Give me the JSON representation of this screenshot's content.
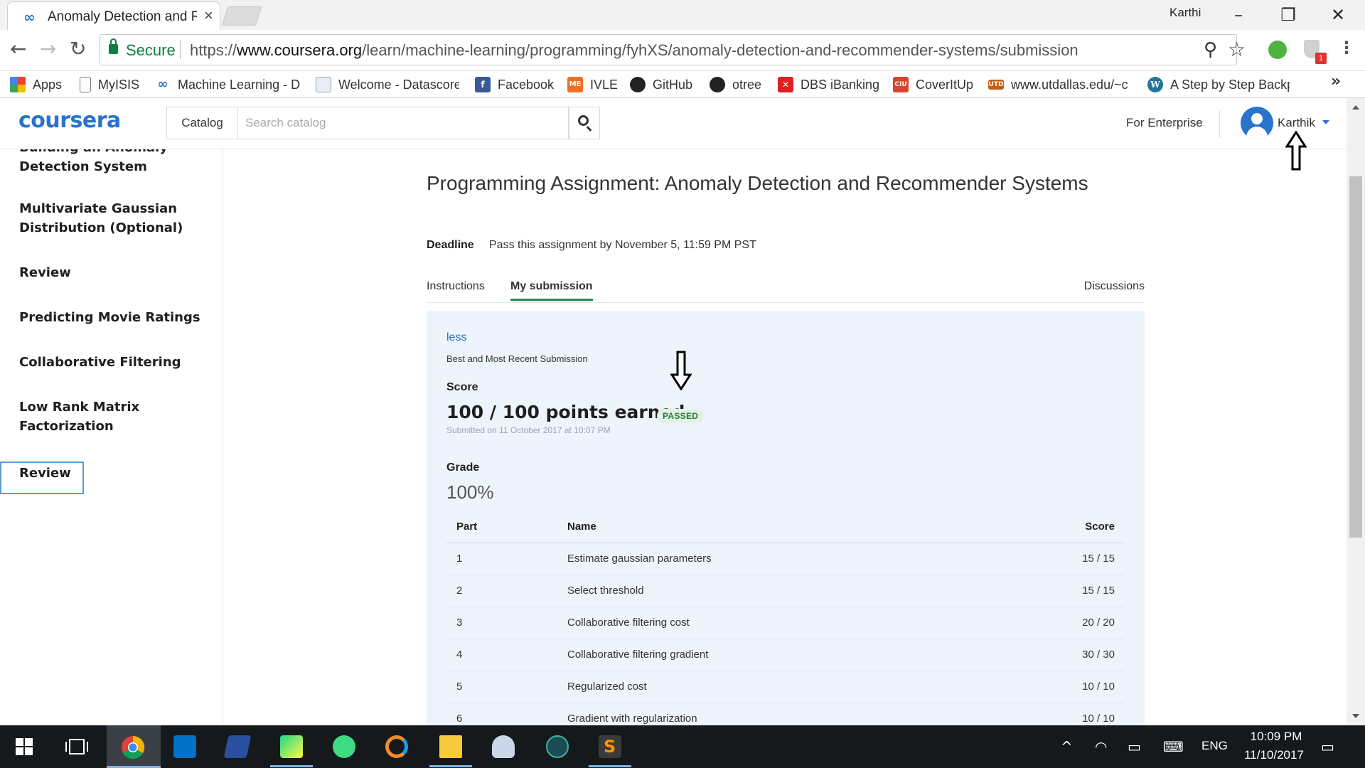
{
  "browser": {
    "tab_title": "Anomaly Detection and R",
    "profile_name": "Karthi",
    "secure_label": "Secure",
    "url_scheme": "https://",
    "url_host": "www.coursera.org",
    "url_path": "/learn/machine-learning/programming/fyhXS/anomaly-detection-and-recommender-systems/submission",
    "extension_badge": "1",
    "bookmarks": [
      {
        "label": "Apps",
        "icon": "apps-grid-icon"
      },
      {
        "label": "MyISIS",
        "icon": "page-icon"
      },
      {
        "label": "Machine Learning - D",
        "icon": "coursera-icon"
      },
      {
        "label": "Welcome - Datascore",
        "icon": "page-icon"
      },
      {
        "label": "Facebook",
        "icon": "facebook-icon"
      },
      {
        "label": "IVLE",
        "icon": "ivle-icon"
      },
      {
        "label": "GitHub",
        "icon": "github-icon"
      },
      {
        "label": "otree",
        "icon": "github-icon"
      },
      {
        "label": "DBS iBanking",
        "icon": "dbs-icon"
      },
      {
        "label": "CoverItUp",
        "icon": "coveritup-icon"
      },
      {
        "label": "www.utdallas.edu/~c",
        "icon": "utd-icon"
      },
      {
        "label": "A Step by Step Backp",
        "icon": "wordpress-icon"
      }
    ],
    "bookmarks_more": "»"
  },
  "site": {
    "logo": "coursera",
    "catalog_label": "Catalog",
    "search_placeholder": "Search catalog",
    "enterprise_label": "For Enterprise",
    "user_name": "Karthik"
  },
  "sidebar": {
    "items": [
      {
        "label": "Building an Anomaly Detection System"
      },
      {
        "label": "Multivariate Gaussian Distribution (Optional)"
      },
      {
        "label": "Review"
      },
      {
        "label": "Predicting Movie Ratings"
      },
      {
        "label": "Collaborative Filtering"
      },
      {
        "label": "Low Rank Matrix Factorization"
      },
      {
        "label": "Review"
      }
    ]
  },
  "main": {
    "title": "Programming Assignment: Anomaly Detection and Recommender Systems",
    "deadline_label": "Deadline",
    "deadline_text": "Pass this assignment by November 5, 11:59 PM PST",
    "tabs": [
      {
        "label": "Instructions"
      },
      {
        "label": "My submission"
      },
      {
        "label": "Discussions"
      }
    ],
    "submission": {
      "toggle_label": "less",
      "caption": "Best and Most Recent Submission",
      "score_label": "Score",
      "score_value": "100 / 100 points earned",
      "status_badge": "PASSED",
      "submitted_text": "Submitted on 11 October 2017 at 10:07 PM",
      "grade_label": "Grade",
      "grade_value": "100%",
      "table_headers": {
        "part": "Part",
        "name": "Name",
        "score": "Score"
      },
      "parts": [
        {
          "part": "1",
          "name": "Estimate gaussian parameters",
          "score": "15 / 15"
        },
        {
          "part": "2",
          "name": "Select threshold",
          "score": "15 / 15"
        },
        {
          "part": "3",
          "name": "Collaborative filtering cost",
          "score": "20 / 20"
        },
        {
          "part": "4",
          "name": "Collaborative filtering gradient",
          "score": "30 / 30"
        },
        {
          "part": "5",
          "name": "Regularized cost",
          "score": "10 / 10"
        },
        {
          "part": "6",
          "name": "Gradient with regularization",
          "score": "10 / 10"
        }
      ]
    }
  },
  "taskbar": {
    "time": "10:09 PM",
    "date": "11/10/2017",
    "language": "ENG"
  },
  "colors": {
    "brand": "#2a73cc",
    "passed": "#1e7e3e",
    "tab_active_underline": "#1e8f5c",
    "panel_bg": "#eef4fb"
  }
}
